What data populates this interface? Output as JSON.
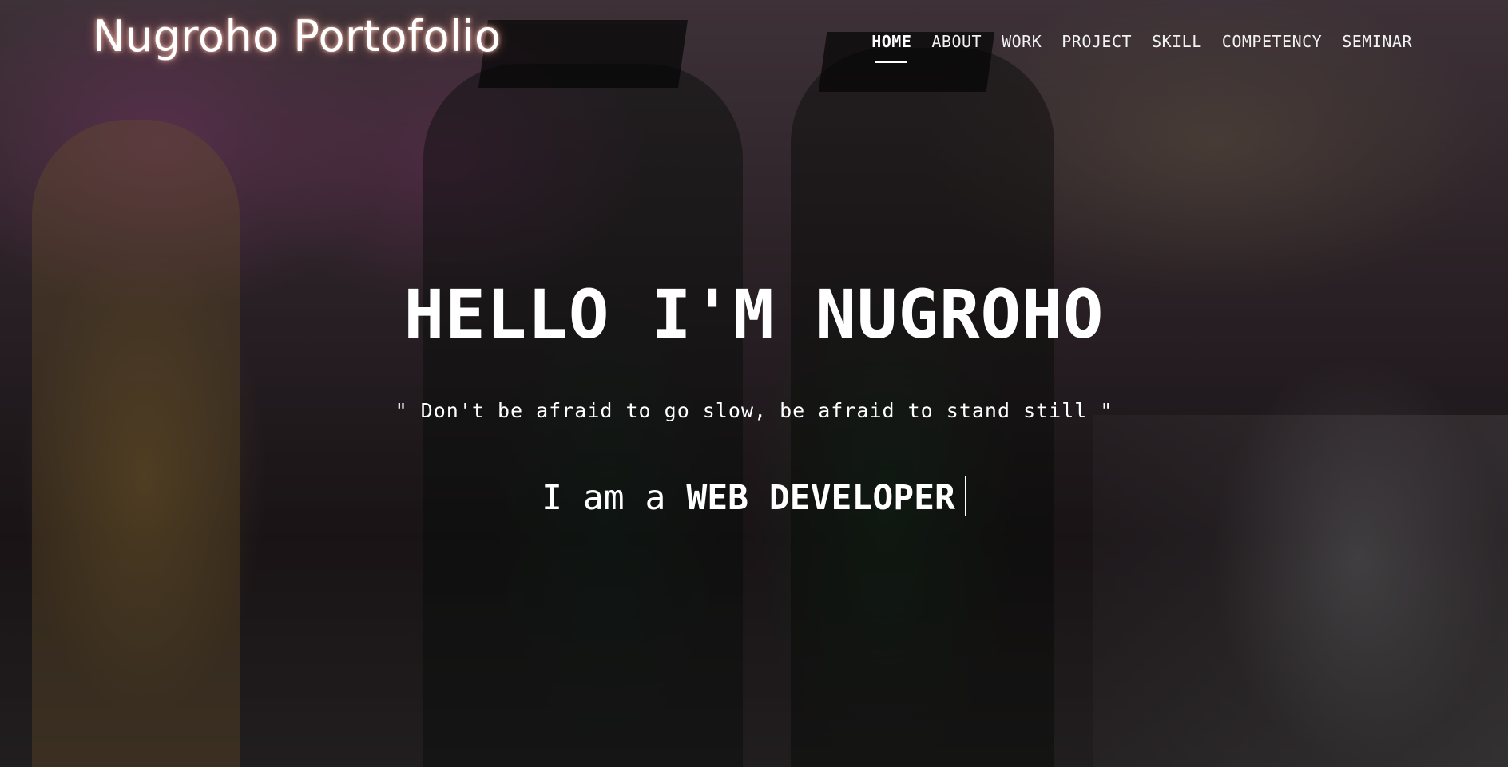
{
  "header": {
    "brand": "Nugroho Portofolio",
    "nav": [
      {
        "label": "HOME",
        "active": true
      },
      {
        "label": "ABOUT",
        "active": false
      },
      {
        "label": "WORK",
        "active": false
      },
      {
        "label": "PROJECT",
        "active": false
      },
      {
        "label": "SKILL",
        "active": false
      },
      {
        "label": "COMPETENCY",
        "active": false
      },
      {
        "label": "SEMINAR",
        "active": false
      }
    ]
  },
  "hero": {
    "headline": "HELLO I'M NUGROHO",
    "quote": "\" Don't be afraid to go slow, be afraid to stand still \"",
    "typed_prefix": "I am a",
    "typed_role": "WEB DEVELOPER"
  },
  "colors": {
    "text": "#ffffff",
    "overlay": "rgba(0,0,0,0.42)"
  }
}
